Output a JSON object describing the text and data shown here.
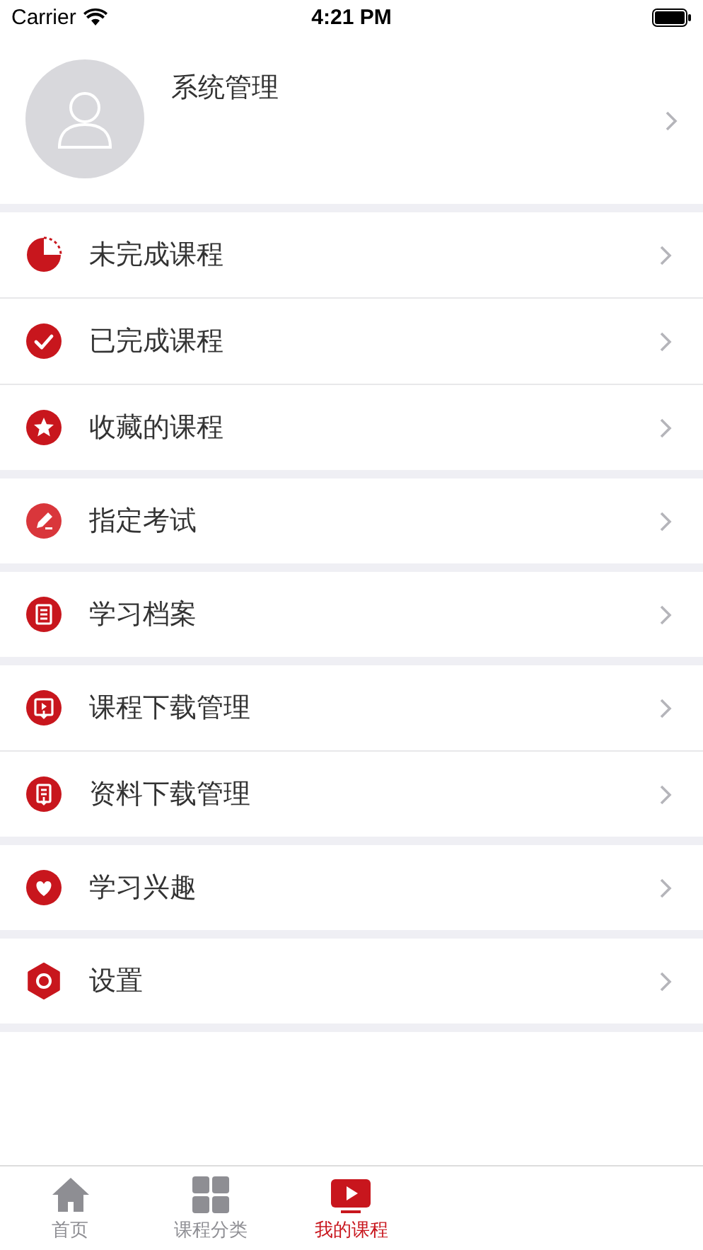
{
  "status_bar": {
    "carrier": "Carrier",
    "time": "4:21 PM"
  },
  "profile": {
    "name": "系统管理"
  },
  "groups": [
    {
      "items": [
        {
          "label": "未完成课程",
          "kind": "pie"
        },
        {
          "label": "已完成课程",
          "kind": "check"
        },
        {
          "label": "收藏的课程",
          "kind": "star"
        }
      ]
    },
    {
      "items": [
        {
          "label": "指定考试",
          "kind": "pencil"
        }
      ]
    },
    {
      "items": [
        {
          "label": "学习档案",
          "kind": "doc"
        }
      ]
    },
    {
      "items": [
        {
          "label": "课程下载管理",
          "kind": "play"
        },
        {
          "label": "资料下载管理",
          "kind": "docdown"
        }
      ]
    },
    {
      "items": [
        {
          "label": "学习兴趣",
          "kind": "heart"
        }
      ]
    },
    {
      "items": [
        {
          "label": "设置",
          "kind": "gear"
        }
      ]
    }
  ],
  "tabs": [
    {
      "label": "首页",
      "kind": "home",
      "selected": false
    },
    {
      "label": "课程分类",
      "kind": "grid",
      "selected": false
    },
    {
      "label": "我的课程",
      "kind": "video",
      "selected": true
    }
  ]
}
